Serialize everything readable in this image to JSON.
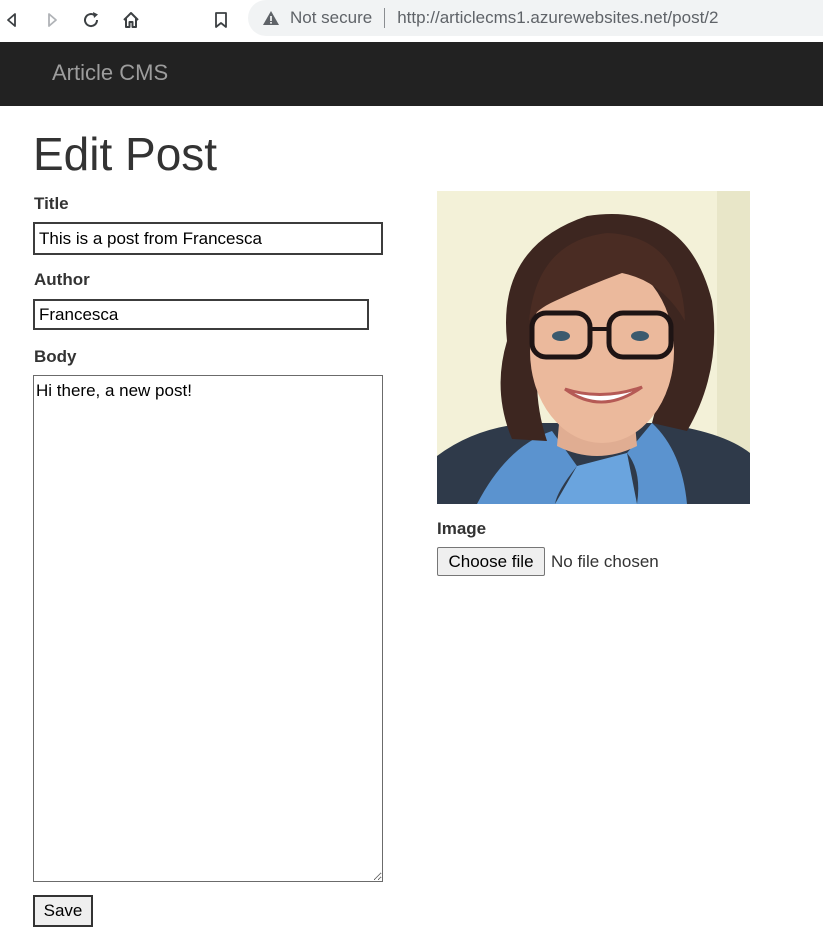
{
  "browser": {
    "security_text": "Not secure",
    "url": "http://articlecms1.azurewebsites.net/post/2"
  },
  "navbar": {
    "brand": "Article CMS"
  },
  "page": {
    "title": "Edit Post"
  },
  "form": {
    "title_label": "Title",
    "title_value": "This is a post from Francesca",
    "author_label": "Author",
    "author_value": "Francesca",
    "body_label": "Body",
    "body_value": "Hi there, a new post!",
    "image_label": "Image",
    "file_button": "Choose file",
    "file_status": "No file chosen",
    "save_label": "Save"
  }
}
